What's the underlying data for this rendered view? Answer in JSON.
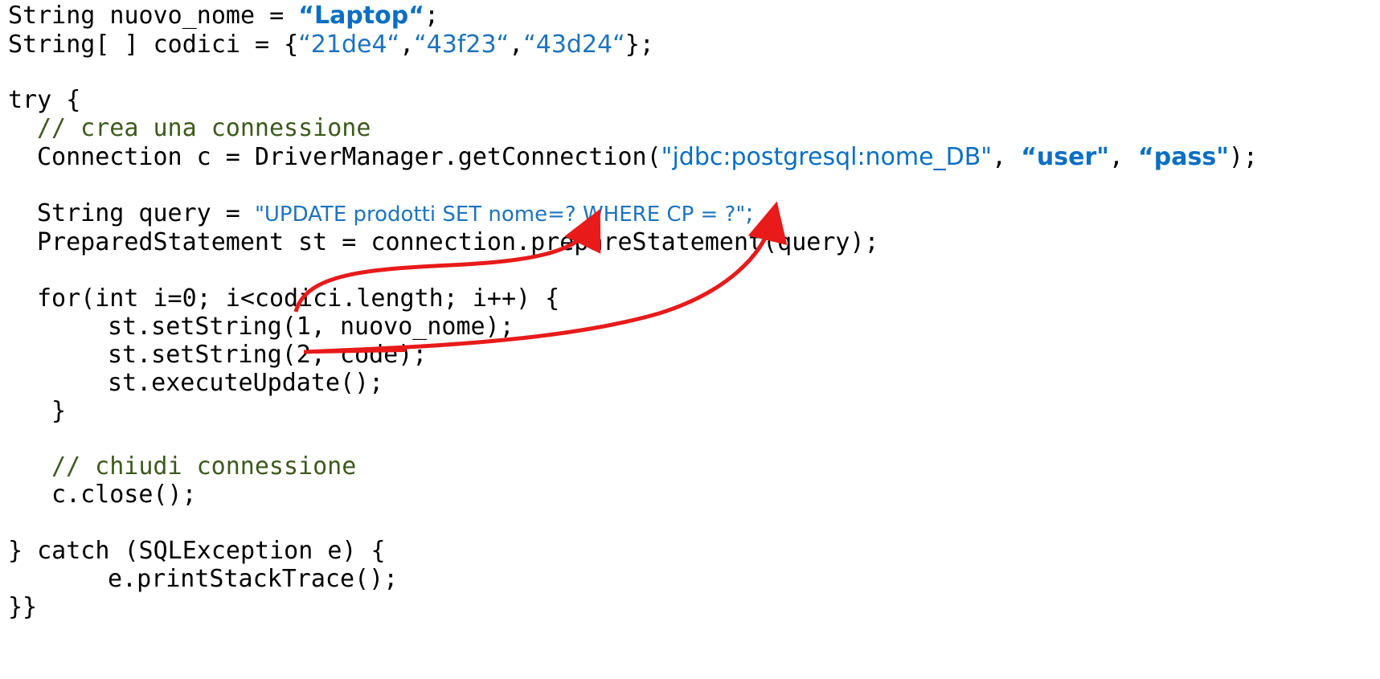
{
  "code": {
    "line1": {
      "kw": "String nuovo_nome = ",
      "val": "“Laptop“",
      "end": ";"
    },
    "line2": {
      "kw": "String[ ] codici = {",
      "a": "“21de4“",
      "sep1": ",",
      "b": "“43f23“",
      "sep2": ",",
      "c": "“43d24“",
      "end": "};"
    },
    "line3": "try {",
    "line4": "// crea una connessione",
    "line5": {
      "pre": "Connection c = DriverManager.getConnection(",
      "url": "\"jdbc:postgresql:nome_DB\"",
      "sep1": ", ",
      "user": "“user\"",
      "sep2": ", ",
      "pass": "“pass\"",
      "end": ");"
    },
    "line6": {
      "pre": "String query = ",
      "sql": "\"UPDATE prodotti SET nome=? WHERE CP = ?\"",
      "end": ";"
    },
    "line7": "PreparedStatement st = connection.prepareStatement(query);",
    "line8": "for(int i=0; i<codici.length; i++) {",
    "line9": "st.setString(1, nuovo_nome);",
    "line10": "st.setString(2, code);",
    "line11": "st.executeUpdate();",
    "line12": "}",
    "line13": "// chiudi connessione",
    "line14": "c.close();",
    "line15": "} catch (SQLException e) {",
    "line16": "e.printStackTrace();",
    "line17": "}}"
  },
  "colors": {
    "string": "#1e73be",
    "comment": "#3d5a1e",
    "text": "#000000",
    "arrow": "#e81a1a"
  }
}
